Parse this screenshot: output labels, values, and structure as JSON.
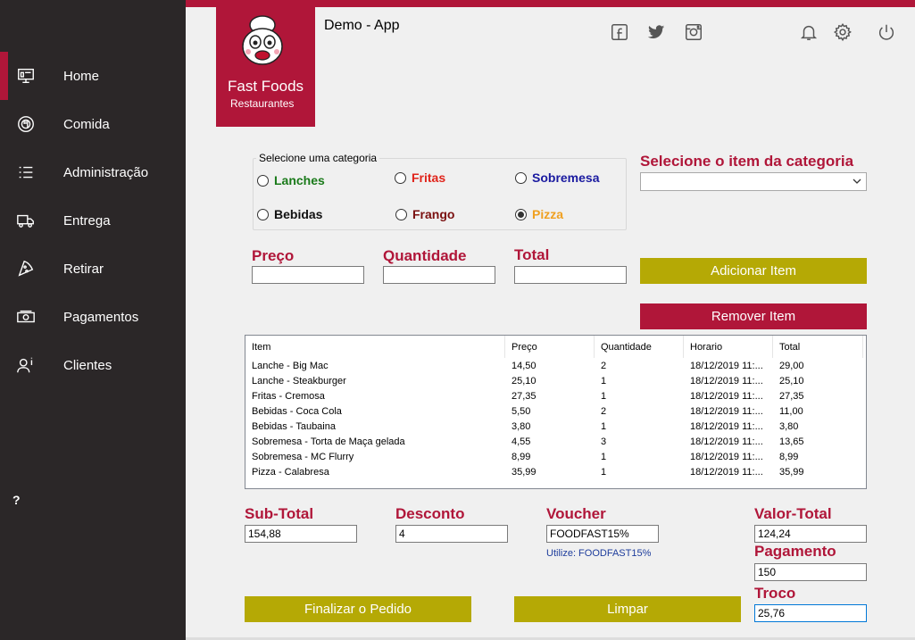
{
  "app": {
    "title": "Demo - App"
  },
  "logo": {
    "title": "Fast Foods",
    "subtitle": "Restaurantes"
  },
  "sidebar": {
    "items": [
      {
        "label": "Home",
        "icon": "monitor-icon"
      },
      {
        "label": "Comida",
        "icon": "food-icon"
      },
      {
        "label": "Administração",
        "icon": "list-icon"
      },
      {
        "label": "Entrega",
        "icon": "truck-icon"
      },
      {
        "label": "Retirar",
        "icon": "pizza-icon"
      },
      {
        "label": "Pagamentos",
        "icon": "money-icon"
      },
      {
        "label": "Clientes",
        "icon": "user-info-icon"
      }
    ],
    "help": "?"
  },
  "category": {
    "legend": "Selecione uma categoria",
    "options": [
      {
        "label": "Lanches",
        "color": "#1a7a1a",
        "checked": false
      },
      {
        "label": "Fritas",
        "color": "#e0241b",
        "checked": false
      },
      {
        "label": "Sobremesa",
        "color": "#1a1aa0",
        "checked": false
      },
      {
        "label": "Bebidas",
        "color": "#111111",
        "checked": false
      },
      {
        "label": "Frango",
        "color": "#7a1010",
        "checked": false
      },
      {
        "label": "Pizza",
        "color": "#f0a020",
        "checked": true
      }
    ]
  },
  "item_select": {
    "label": "Selecione o item da categoria",
    "value": ""
  },
  "fields": {
    "preco": {
      "label": "Preço",
      "value": ""
    },
    "quantidade": {
      "label": "Quantidade",
      "value": ""
    },
    "total": {
      "label": "Total",
      "value": ""
    }
  },
  "buttons": {
    "add": "Adicionar Item",
    "remove": "Remover Item",
    "finish": "Finalizar o Pedido",
    "clear": "Limpar"
  },
  "table": {
    "columns": [
      "Item",
      "Preço",
      "Quantidade",
      "Horario",
      "Total"
    ],
    "rows": [
      [
        "Lanche - Big Mac",
        "14,50",
        "2",
        "18/12/2019 11:...",
        "29,00"
      ],
      [
        "Lanche - Steakburger",
        "25,10",
        "1",
        "18/12/2019 11:...",
        "25,10"
      ],
      [
        "Fritas - Cremosa",
        "27,35",
        "1",
        "18/12/2019 11:...",
        "27,35"
      ],
      [
        "Bebidas - Coca Cola",
        "5,50",
        "2",
        "18/12/2019 11:...",
        "11,00"
      ],
      [
        "Bebidas - Taubaina",
        "3,80",
        "1",
        "18/12/2019 11:...",
        "3,80"
      ],
      [
        "Sobremesa - Torta de Maça gelada",
        "4,55",
        "3",
        "18/12/2019 11:...",
        "13,65"
      ],
      [
        "Sobremesa - MC Flurry",
        "8,99",
        "1",
        "18/12/2019 11:...",
        "8,99"
      ],
      [
        "Pizza - Calabresa",
        "35,99",
        "1",
        "18/12/2019 11:...",
        "35,99"
      ]
    ]
  },
  "summary": {
    "subtotal": {
      "label": "Sub-Total",
      "value": "154,88"
    },
    "desconto": {
      "label": "Desconto",
      "value": "4"
    },
    "voucher": {
      "label": "Voucher",
      "value": "FOODFAST15%",
      "hint": "Utilize: FOODFAST15%"
    },
    "valor_total": {
      "label": "Valor-Total",
      "value": "124,24"
    },
    "pagamento": {
      "label": "Pagamento",
      "value": "150"
    },
    "troco": {
      "label": "Troco",
      "value": "25,76"
    }
  },
  "colors": {
    "accent": "#b01639",
    "olive": "#b5a905",
    "sidebar": "#2b2728"
  }
}
